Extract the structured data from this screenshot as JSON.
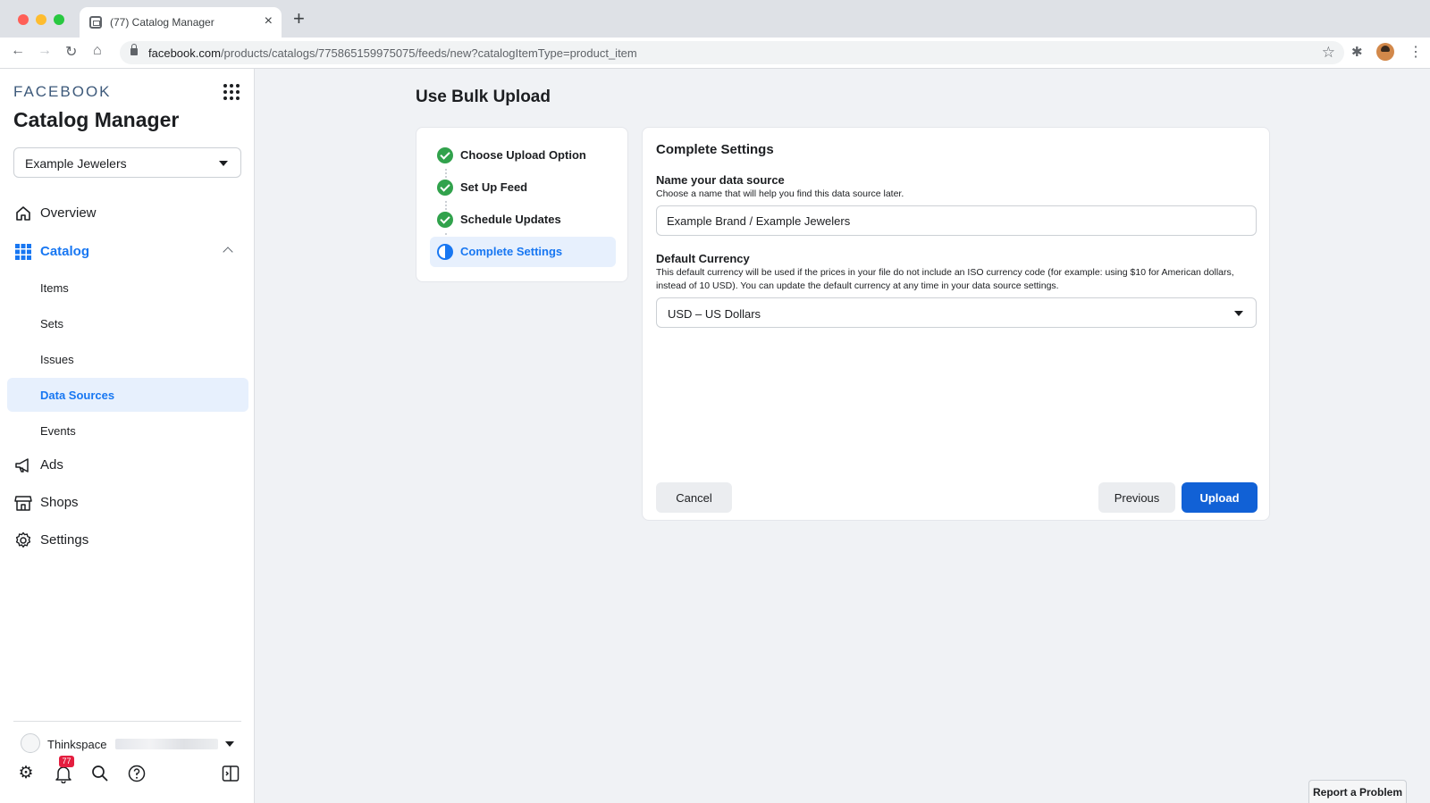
{
  "browser": {
    "tab_title": "(77) Catalog Manager",
    "url_host": "facebook.com",
    "url_path": "/products/catalogs/775865159975075/feeds/new?catalogItemType=product_item"
  },
  "sidebar": {
    "brand": "FACEBOOK",
    "app_title": "Catalog Manager",
    "business_selector": "Example Jewelers",
    "nav": {
      "overview": "Overview",
      "catalog": "Catalog",
      "items": "Items",
      "sets": "Sets",
      "issues": "Issues",
      "data_sources": "Data Sources",
      "events": "Events",
      "ads": "Ads",
      "shops": "Shops",
      "settings": "Settings"
    },
    "account_name": "Thinkspace",
    "notification_count": "77"
  },
  "main": {
    "page_title": "Use Bulk Upload",
    "steps": [
      {
        "label": "Choose Upload Option",
        "status": "complete"
      },
      {
        "label": "Set Up Feed",
        "status": "complete"
      },
      {
        "label": "Schedule Updates",
        "status": "complete"
      },
      {
        "label": "Complete Settings",
        "status": "current"
      }
    ],
    "settings": {
      "heading": "Complete Settings",
      "name_label": "Name your data source",
      "name_help": "Choose a name that will help you find this data source later.",
      "name_value": "Example Brand / Example Jewelers",
      "currency_label": "Default Currency",
      "currency_help": "This default currency will be used if the prices in your file do not include an ISO currency code (for example: using $10 for American dollars, instead of 10 USD). You can update the default currency at any time in your data source settings.",
      "currency_value": "USD – US Dollars",
      "cancel_label": "Cancel",
      "previous_label": "Previous",
      "upload_label": "Upload"
    }
  },
  "report_problem": "Report a Problem",
  "colors": {
    "accent": "#1877f2",
    "primary_button": "#1161d6",
    "success": "#31a24c",
    "badge": "#e41e3f"
  }
}
